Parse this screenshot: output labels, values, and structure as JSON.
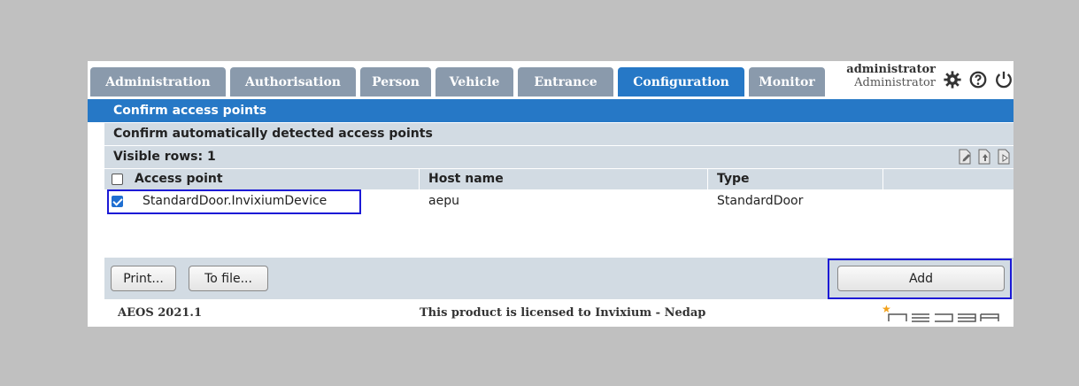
{
  "tabs": [
    {
      "label": "Administration",
      "active": false
    },
    {
      "label": "Authorisation",
      "active": false
    },
    {
      "label": "Person",
      "active": false
    },
    {
      "label": "Vehicle",
      "active": false
    },
    {
      "label": "Entrance",
      "active": false
    },
    {
      "label": "Configuration",
      "active": true
    },
    {
      "label": "Monitor",
      "active": false
    }
  ],
  "user": {
    "name": "administrator",
    "role": "Administrator"
  },
  "icons": {
    "settings": "gear-icon",
    "help": "help-icon",
    "logout": "power-icon"
  },
  "panel": {
    "title": "Confirm access points",
    "subtitle": "Confirm automatically detected access points",
    "visible_rows": "Visible rows: 1"
  },
  "table": {
    "columns": [
      "Access point",
      "Host name",
      "Type"
    ],
    "rows": [
      {
        "checked": true,
        "access_point": "StandardDoor.InvixiumDevice",
        "host_name": "aepu",
        "type": "StandardDoor"
      }
    ]
  },
  "buttons": {
    "print": "Print...",
    "to_file": "To file...",
    "add": "Add"
  },
  "footer": {
    "version": "AEOS 2021.1",
    "license": "This product is licensed to Invixium - Nedap",
    "brand": "nedap"
  },
  "colors": {
    "accent": "#2678c6",
    "tab_inactive": "#8a9aac",
    "header_bg": "#d2dbe3",
    "highlight": "#1c1ad6"
  }
}
